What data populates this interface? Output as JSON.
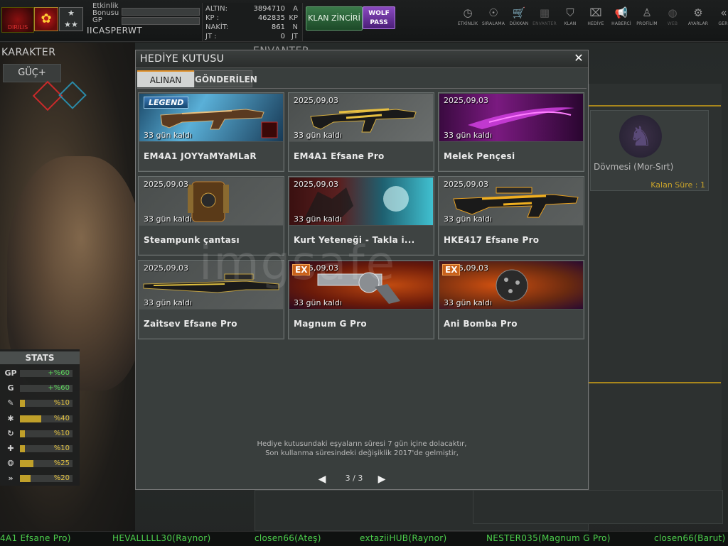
{
  "header": {
    "etkinlik_bonusu": "Etkinlik Bonusu",
    "gp_label": "GP",
    "username": "IICASPERWT",
    "clan_logo_text": "DIRILIS",
    "currency": [
      {
        "label": "ALTIN:",
        "value": "3894710",
        "unit": "A"
      },
      {
        "label": "KP :",
        "value": "462835",
        "unit": "KP"
      },
      {
        "label": "NAKİT:",
        "value": "861",
        "unit": "N"
      },
      {
        "label": "JT :",
        "value": "0",
        "unit": "JT"
      }
    ],
    "klan_zinciri": "KLAN ZİNCİRİ",
    "wolf_pass_line1": "WOLF",
    "wolf_pass_line2": "PASS",
    "nav": [
      {
        "label": "ETKİNLİK",
        "icon": "clock-icon",
        "glyph": "◷"
      },
      {
        "label": "SIRALAMA",
        "icon": "medal-icon",
        "glyph": "☉"
      },
      {
        "label": "DÜKKAN",
        "icon": "cart-icon",
        "glyph": "🛒"
      },
      {
        "label": "ENVANTER",
        "icon": "inventory-icon",
        "glyph": "▦"
      },
      {
        "label": "KLAN",
        "icon": "shield-icon",
        "glyph": "⛉"
      },
      {
        "label": "HEDİYE",
        "icon": "gift-icon",
        "glyph": "⌧"
      },
      {
        "label": "HABERCİ",
        "icon": "megaphone-icon",
        "glyph": "📢"
      },
      {
        "label": "PROFİLİM",
        "icon": "profile-icon",
        "glyph": "♙"
      },
      {
        "label": "WEB",
        "icon": "globe-icon",
        "glyph": "◍"
      },
      {
        "label": "AYARLAR",
        "icon": "gear-icon",
        "glyph": "⚙"
      },
      {
        "label": "GERİ",
        "icon": "back-icon",
        "glyph": "«"
      }
    ]
  },
  "left": {
    "karakter": "KARAKTER",
    "guc": "GÜÇ+",
    "stats_title": "STATS",
    "stats": [
      {
        "icon": "gp-icon",
        "glyph": "GP",
        "value": "+%60",
        "fill": 0,
        "color": "#5ad05a"
      },
      {
        "icon": "g-icon",
        "glyph": "G",
        "value": "+%60",
        "fill": 0,
        "color": "#5ad05a"
      },
      {
        "icon": "stamina-icon",
        "glyph": "✎",
        "value": "%10",
        "fill": 0.1,
        "color": "#e0c040"
      },
      {
        "icon": "speed-icon",
        "glyph": "✱",
        "value": "%40",
        "fill": 0.4,
        "color": "#e0c040"
      },
      {
        "icon": "reload-icon",
        "glyph": "↻",
        "value": "%10",
        "fill": 0.1,
        "color": "#e0c040"
      },
      {
        "icon": "heal-icon",
        "glyph": "✚",
        "value": "%10",
        "fill": 0.1,
        "color": "#e0c040"
      },
      {
        "icon": "skill-icon",
        "glyph": "❂",
        "value": "%25",
        "fill": 0.25,
        "color": "#e0c040"
      },
      {
        "icon": "dash-icon",
        "glyph": "»",
        "value": "%20",
        "fill": 0.2,
        "color": "#e0c040"
      }
    ]
  },
  "background": {
    "envanter": "ENVANTER",
    "right_card_name": "Dövmesi (Mor-Sırt)",
    "right_card_time": "Kalan Süre : 1"
  },
  "modal": {
    "title": "HEDİYE KUTUSU",
    "close": "✕",
    "tabs": [
      "ALINAN",
      "GÖNDERİLEN"
    ],
    "items": [
      {
        "name": "EM4A1 JOYYaMYaMLaR",
        "date": "2025,09,03",
        "days": "33 gün kaldı",
        "badge": "LEGEND",
        "art": "rifle-legend"
      },
      {
        "name": "EM4A1 Efsane Pro",
        "date": "2025,09,03",
        "days": "33 gün kaldı",
        "badge": "",
        "art": "rifle-gold"
      },
      {
        "name": "Melek Pençesi",
        "date": "2025,09,03",
        "days": "33 gün kaldı",
        "badge": "",
        "art": "claw"
      },
      {
        "name": "Steampunk çantası",
        "date": "2025,09,03",
        "days": "33 gün kaldı",
        "badge": "",
        "art": "backpack"
      },
      {
        "name": "Kurt Yeteneği - Takla i...",
        "date": "2025,09,03",
        "days": "33 gün kaldı",
        "badge": "",
        "art": "wolf-skill"
      },
      {
        "name": "HKE417 Efsane Pro",
        "date": "2025,09,03",
        "days": "33 gün kaldı",
        "badge": "",
        "art": "rifle-gold2"
      },
      {
        "name": "Zaitsev Efsane Pro",
        "date": "2025,09,03",
        "days": "33 gün kaldı",
        "badge": "",
        "art": "sniper"
      },
      {
        "name": "Magnum G Pro",
        "date": "2025,09,03",
        "days": "33 gün kaldı",
        "badge": "EX",
        "art": "revolver"
      },
      {
        "name": "Ani Bomba Pro",
        "date": "2025,09,03",
        "days": "33 gün kaldı",
        "badge": "EX",
        "art": "bomb"
      }
    ],
    "footer_line1": "Hediye kutusundaki eşyaların süresi 7 gün içine dolacaktır,",
    "footer_line2": "Son kullanma süresindeki değişiklik 2017'de gelmiştir,",
    "page": "3 / 3",
    "prev_glyph": "◀",
    "next_glyph": "▶"
  },
  "watermark": "imgsafe",
  "ticker": [
    "4A1 Efsane Pro)",
    "HEVALLLLL30(Raynor)",
    "closen66(Ateş)",
    "extaziiHUB(Raynor)",
    "NESTER035(Magnum G Pro)",
    "closen66(Barut)"
  ]
}
